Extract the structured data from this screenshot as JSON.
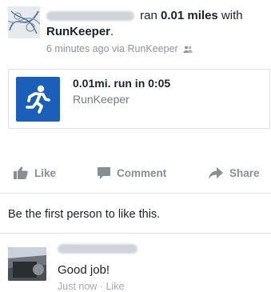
{
  "post": {
    "action_text": "ran",
    "distance": "0.01 miles",
    "with_text": "with",
    "app_name": "RunKeeper",
    "period": ".",
    "timestamp": "6 minutes ago via RunKeeper",
    "audience_icon": "friends-icon"
  },
  "attachment": {
    "icon": "running-person-icon",
    "accent_color": "#1c5fb8",
    "title": "0.01mi. run in 0:05",
    "subtitle": "RunKeeper"
  },
  "actions": {
    "like_label": "Like",
    "comment_label": "Comment",
    "share_label": "Share"
  },
  "likes_text": "Be the first person to like this.",
  "comment": {
    "text": "Good job!",
    "time": "Just now",
    "separator": "·",
    "like_label": "Like"
  }
}
